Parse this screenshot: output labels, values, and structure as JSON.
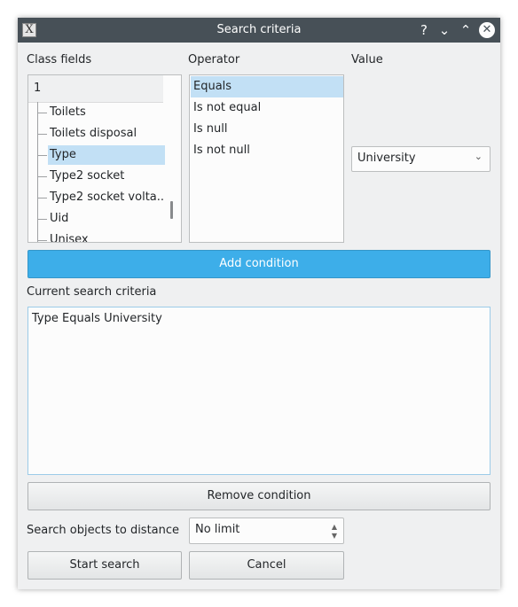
{
  "window": {
    "title": "Search criteria",
    "app_icon_glyph": "X",
    "help_glyph": "?",
    "minimize_glyph": "⌄",
    "maximize_glyph": "⌃",
    "close_glyph": "✕"
  },
  "class_fields": {
    "label": "Class fields",
    "header": "1",
    "items": [
      "Toilets",
      "Toilets disposal",
      "Type",
      "Type2 socket",
      "Type2 socket volta...",
      "Uid",
      "Unisex"
    ],
    "selected": "Type"
  },
  "operator": {
    "label": "Operator",
    "items": [
      "Equals",
      "Is not equal",
      "Is null",
      "Is not null"
    ],
    "selected": "Equals"
  },
  "value": {
    "label": "Value",
    "selected": "University"
  },
  "add_condition_label": "Add condition",
  "current_criteria": {
    "label": "Current search criteria",
    "text": "Type Equals University"
  },
  "remove_condition_label": "Remove condition",
  "distance": {
    "label": "Search objects to distance",
    "value": "No limit"
  },
  "start_search_label": "Start search",
  "cancel_label": "Cancel",
  "colors": {
    "titlebar": "#475057",
    "window_bg": "#eff0f1",
    "selection": "#c2e0f5",
    "accent": "#3daee9"
  }
}
